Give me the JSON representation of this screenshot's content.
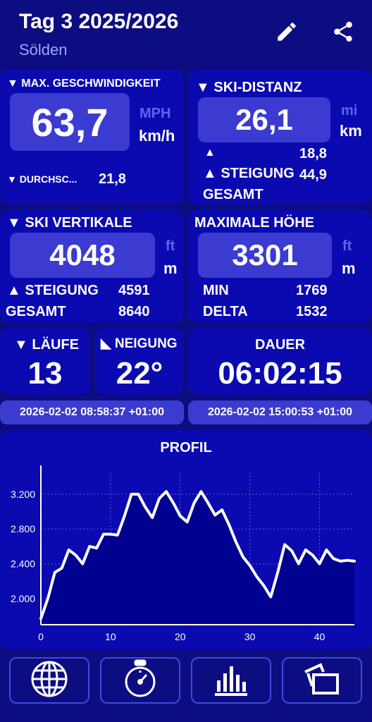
{
  "header": {
    "title": "Tag 3 2025/2026",
    "subtitle": "Sölden",
    "icons": {
      "edit": "pencil-icon",
      "share": "share-icon"
    }
  },
  "speed": {
    "title": "▼ MAX. GESCHWINDIGKEIT",
    "value": "63,7",
    "unit_alt": "MPH",
    "unit": "km/h",
    "avg_label": "▼ DURCHSC...",
    "avg_value": "21,8"
  },
  "distance": {
    "title": "▼ SKI-DISTANZ",
    "value": "26,1",
    "unit_alt": "mi",
    "unit": "km",
    "climb_label": "▲ STEIGUNG",
    "climb_value_top": "18,8",
    "climb_value": "44,9",
    "total_label": "GESAMT"
  },
  "vertical": {
    "title": "▼ SKI VERTIKALE",
    "value": "4048",
    "unit_alt": "ft",
    "unit": "m",
    "climb_label": "▲ STEIGUNG",
    "climb_value": "4591",
    "total_label": "GESAMT",
    "total_value": "8640"
  },
  "altitude": {
    "title": "MAXIMALE HÖHE",
    "value": "3301",
    "unit_alt": "ft",
    "unit": "m",
    "min_label": "MIN",
    "min_value": "1769",
    "delta_label": "DELTA",
    "delta_value": "1532"
  },
  "runs": {
    "title": "▼ LÄUFE",
    "value": "13"
  },
  "slope": {
    "title": "◣ NEIGUNG",
    "value": "22°"
  },
  "duration": {
    "title": "DAUER",
    "value": "06:02:15"
  },
  "times": {
    "start": "2026-02-02 08:58:37 +01:00",
    "end": "2026-02-02 15:00:53 +01:00"
  },
  "profile": {
    "title": "PROFIL"
  },
  "chart_data": {
    "type": "area",
    "title": "PROFIL",
    "xlabel": "",
    "ylabel": "",
    "xlim": [
      0,
      45
    ],
    "ylim": [
      1700,
      3450
    ],
    "x_ticks": [
      "0",
      "10",
      "20",
      "30",
      "40"
    ],
    "y_ticks": [
      "2.000",
      "2.400",
      "2.800",
      "3.200"
    ],
    "grid": true,
    "x": [
      0,
      1,
      2,
      3,
      4,
      5,
      6,
      7,
      8,
      9,
      10,
      11,
      12,
      13,
      14,
      15,
      16,
      17,
      18,
      19,
      20,
      21,
      22,
      23,
      24,
      25,
      26,
      27,
      28,
      29,
      30,
      31,
      32,
      33,
      34,
      35,
      36,
      37,
      38,
      39,
      40,
      41,
      42,
      43,
      44,
      45
    ],
    "values": [
      1770,
      2000,
      2300,
      2350,
      2560,
      2500,
      2400,
      2600,
      2580,
      2740,
      2740,
      2730,
      2950,
      3200,
      3200,
      3050,
      2930,
      3150,
      3230,
      3100,
      2950,
      2880,
      3100,
      3230,
      3100,
      2960,
      3020,
      2850,
      2650,
      2480,
      2380,
      2250,
      2150,
      2020,
      2300,
      2620,
      2550,
      2400,
      2560,
      2500,
      2400,
      2560,
      2460,
      2430,
      2440,
      2430
    ]
  },
  "nav": [
    {
      "name": "globe-icon"
    },
    {
      "name": "stopwatch-icon"
    },
    {
      "name": "bar-chart-icon"
    },
    {
      "name": "photos-icon"
    }
  ]
}
